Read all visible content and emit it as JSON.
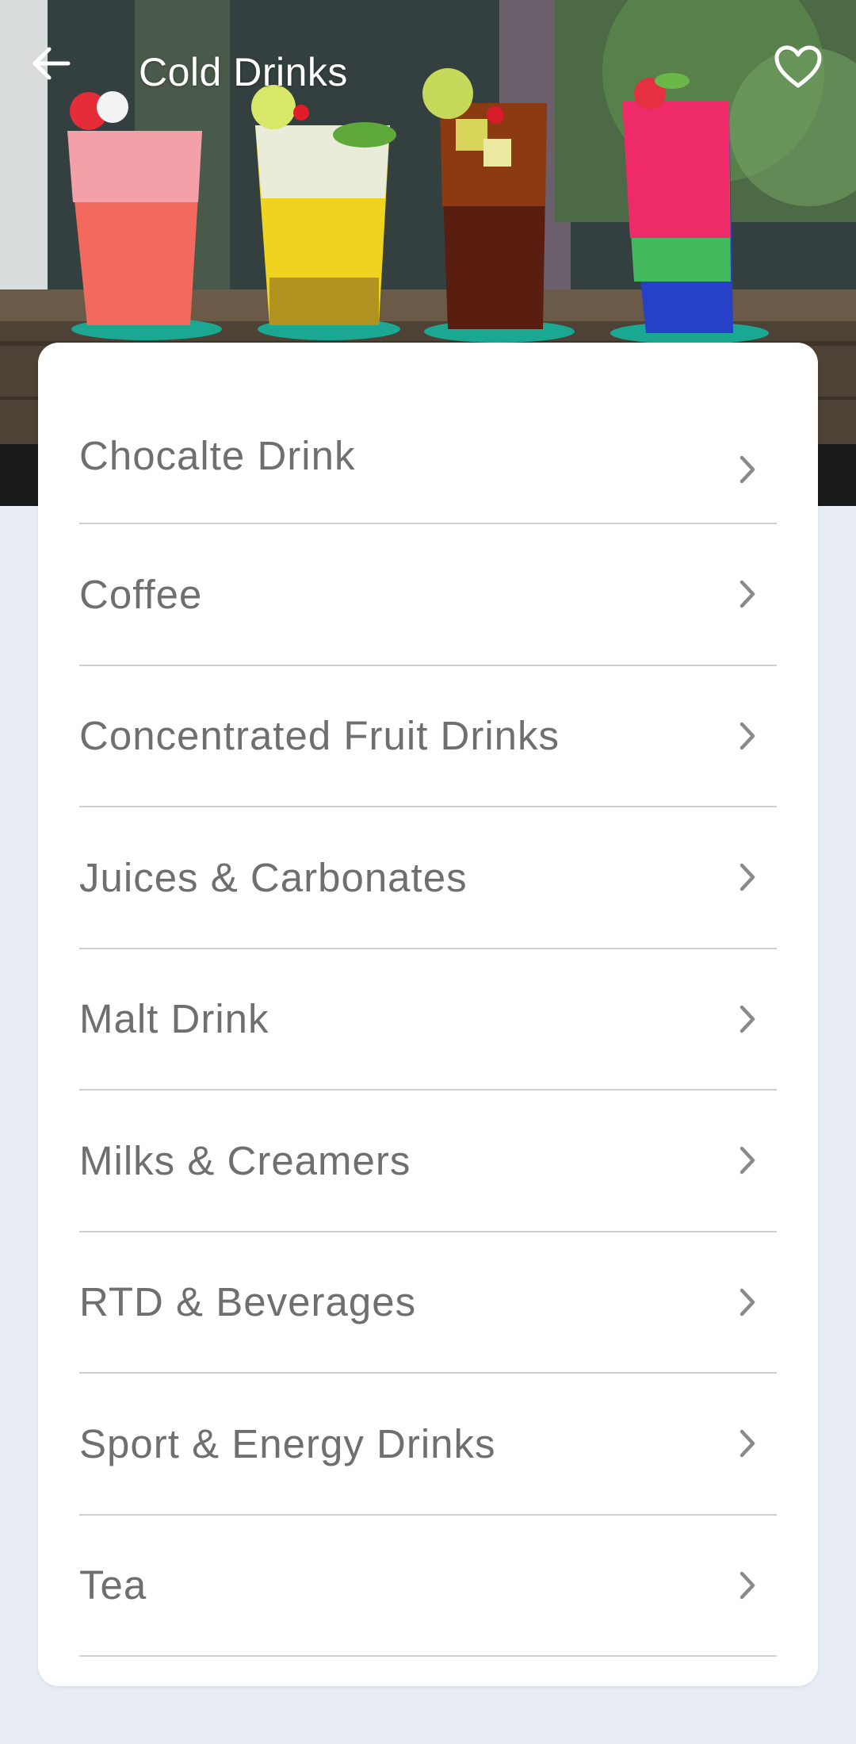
{
  "appbar": {
    "title": "Cold Drinks",
    "back_icon": "arrow-left-icon",
    "favorite_icon": "heart-outline-icon"
  },
  "hero": {
    "image": "four-cold-drinks-in-glasses-photo"
  },
  "categories": [
    {
      "label": "Chocalte Drink"
    },
    {
      "label": "Coffee"
    },
    {
      "label": "Concentrated Fruit Drinks"
    },
    {
      "label": "Juices & Carbonates"
    },
    {
      "label": "Malt Drink"
    },
    {
      "label": "Milks & Creamers"
    },
    {
      "label": "RTD & Beverages"
    },
    {
      "label": "Sport & Energy Drinks"
    },
    {
      "label": "Tea"
    }
  ],
  "colors": {
    "background": "#e8edf5",
    "card": "#ffffff",
    "item_text": "#6f6f6f",
    "divider": "#cfcfcf",
    "chevron": "#8a8a8a"
  }
}
